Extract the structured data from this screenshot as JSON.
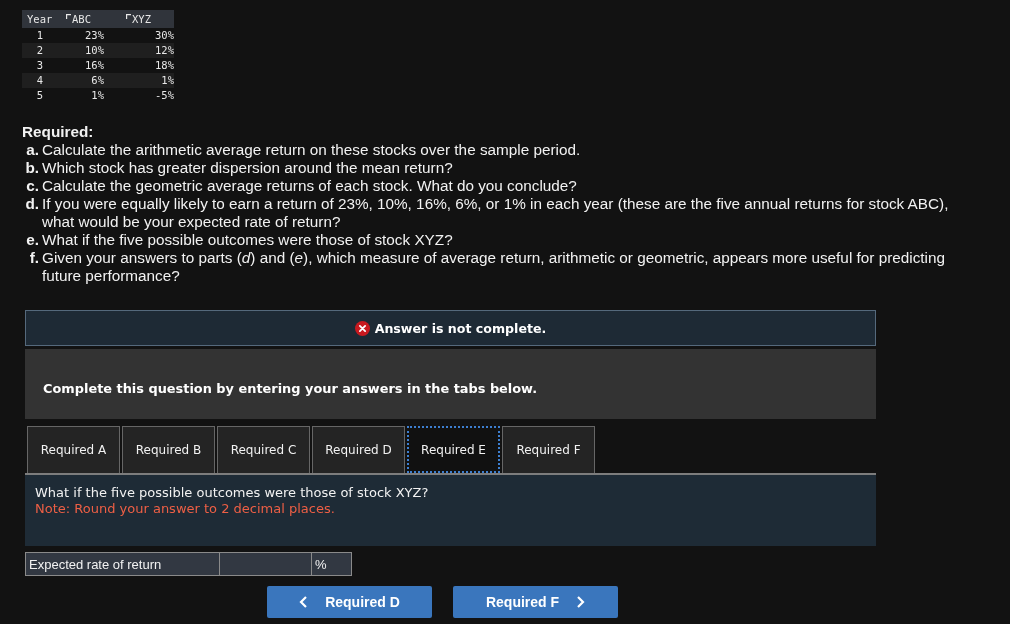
{
  "data_table": {
    "columns": [
      {
        "label": "Year",
        "marked": false
      },
      {
        "label": "ABC",
        "marked": true
      },
      {
        "label": "XYZ",
        "marked": true
      }
    ],
    "rows": [
      [
        "1",
        "23%",
        "30%"
      ],
      [
        "2",
        "10%",
        "12%"
      ],
      [
        "3",
        "16%",
        "18%"
      ],
      [
        "4",
        "6%",
        "1%"
      ],
      [
        "5",
        "1%",
        "-5%"
      ]
    ]
  },
  "required": {
    "heading": "Required:",
    "items": [
      {
        "letter": "a.",
        "text": "Calculate the arithmetic average return on these stocks over the sample period."
      },
      {
        "letter": "b.",
        "text": "Which stock has greater dispersion around the mean return?"
      },
      {
        "letter": "c.",
        "text": "Calculate the geometric average returns of each stock. What do you conclude?"
      },
      {
        "letter": "d.",
        "text": "If you were equally likely to earn a return of 23%, 10%, 16%, 6%, or 1% in each year (these are the five annual returns for stock ABC), what would be your expected rate of return?"
      },
      {
        "letter": "e.",
        "text": "What if the five possible outcomes were those of stock XYZ?"
      },
      {
        "letter": "f.",
        "text": "Given your answers to parts (*d*) and (*e*), which measure of average return, arithmetic or geometric, appears more useful for predicting future performance?"
      }
    ]
  },
  "alert": {
    "kind": "error",
    "text": "Answer is not complete."
  },
  "instruction": "Complete this question by entering your answers in the tabs below.",
  "tabs": [
    {
      "label": "Required A",
      "selected": false
    },
    {
      "label": "Required B",
      "selected": false
    },
    {
      "label": "Required C",
      "selected": false
    },
    {
      "label": "Required D",
      "selected": false
    },
    {
      "label": "Required E",
      "selected": true
    },
    {
      "label": "Required F",
      "selected": false
    }
  ],
  "panel": {
    "question": "What if the five possible outcomes were those of stock XYZ?",
    "note": "Note: Round your answer to 2 decimal places."
  },
  "answer_row": {
    "label": "Expected rate of return",
    "unit": "%"
  },
  "nav_buttons": [
    {
      "kind": "prev",
      "label": "Required D"
    },
    {
      "kind": "next",
      "label": "Required F"
    }
  ]
}
